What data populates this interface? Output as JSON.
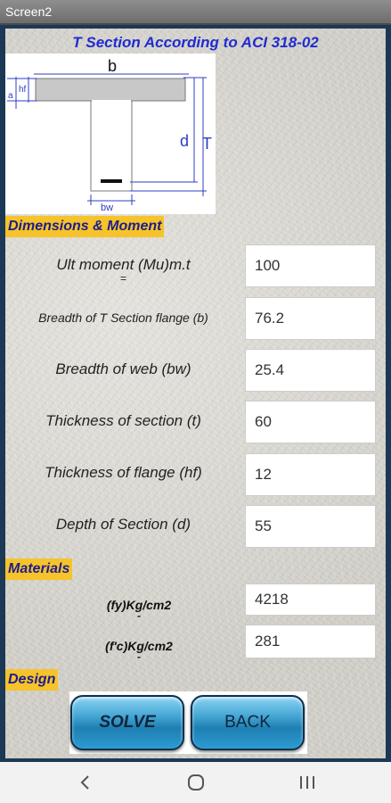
{
  "window": {
    "title": "Screen2"
  },
  "heading": "T Section According to ACI 318-02",
  "diagram": {
    "b": "b",
    "hf": "hf",
    "a": "a",
    "d": "d",
    "T": "T",
    "bw": "bw"
  },
  "sections": {
    "dimensions": "Dimensions & Moment",
    "materials": "Materials",
    "design": "Design"
  },
  "fields": [
    {
      "label": "Ult moment (Mu)m.t",
      "sub": "=",
      "value": "100"
    },
    {
      "label": "Breadth of T Section flange (b)",
      "value": "76.2"
    },
    {
      "label": "Breadth of web (bw)",
      "value": "25.4"
    },
    {
      "label": "Thickness of section (t)",
      "value": "60"
    },
    {
      "label": "Thickness of  flange (hf)",
      "value": "12"
    },
    {
      "label": "Depth  of Section (d)",
      "value": "55"
    }
  ],
  "materials": [
    {
      "label": "(fy)Kg/cm2",
      "sub": "-",
      "value": "4218"
    },
    {
      "label": "(f'c)Kg/cm2",
      "sub": "-",
      "value": "281"
    }
  ],
  "buttons": {
    "solve": "SOLVE",
    "back": "BACK"
  },
  "nav": {
    "back_icon": "chevron-left-icon",
    "home_icon": "home-circle-icon",
    "recents_icon": "recents-bars-icon"
  }
}
